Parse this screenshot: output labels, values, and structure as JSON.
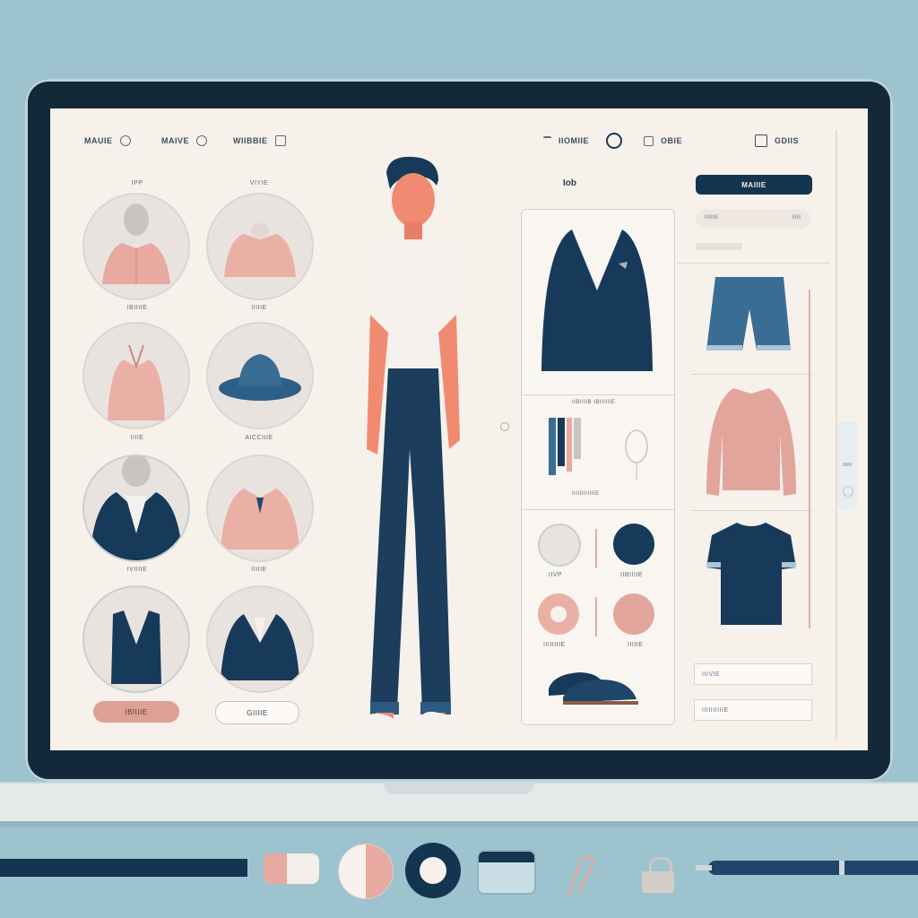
{
  "nav": {
    "items": [
      {
        "label": "MAUIE",
        "icon": "search-icon"
      },
      {
        "label": "MAIVE",
        "icon": "globe-icon"
      },
      {
        "label": "WIIBBIE",
        "icon": "cup-icon"
      },
      {
        "label": "IIOMIIE",
        "icon": "filter-icon"
      },
      {
        "label": "OBIE",
        "icon": "square-icon"
      },
      {
        "label": "GDIIS",
        "icon": "bag-icon"
      }
    ]
  },
  "categories": {
    "top_labels": [
      "IPP",
      "VIYIE"
    ],
    "row_labels": [
      [
        "IBIIIIE",
        "IIIIIE"
      ],
      [
        "IIIIE",
        "AICCIIIE"
      ],
      [
        "IVIIIIE",
        "IIIIIE"
      ]
    ],
    "buttons": {
      "primary": "IBIIIIE",
      "secondary": "GIIIIE"
    }
  },
  "middle": {
    "title": "Iob",
    "section_label": "IIBIIIIB IBIIIIIIE",
    "section_label_2": "IIIIIIIIIIIIE",
    "swatch_labels": [
      "IIVP",
      "IIBIIIIE",
      "IIIIIIIIE",
      "IIIIIE"
    ]
  },
  "right": {
    "main_button": "MAIIIE",
    "search_placeholder_left": "IIIIIIIE",
    "search_placeholder_right": "IIIIE",
    "field_1": "IIIVIE",
    "field_2": "IIIIIIIIIIE"
  },
  "colors": {
    "navy": "#13354f",
    "blush": "#e8a9a0",
    "screen_bg": "#f7f1ec",
    "desk_bg": "#9dc3cf"
  }
}
